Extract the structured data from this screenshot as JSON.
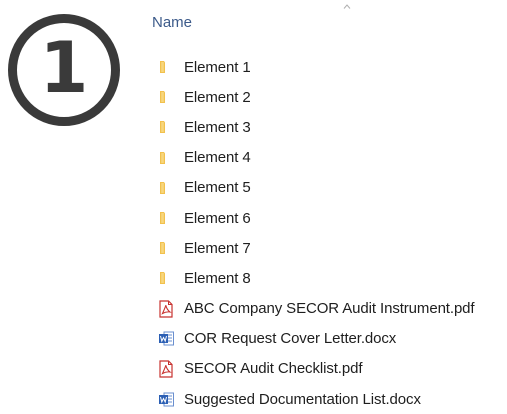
{
  "step_number": "1",
  "header": {
    "name_label": "Name"
  },
  "icons": {
    "folder": "folder-icon",
    "pdf": "pdf-file-icon",
    "word": "word-document-icon"
  },
  "colors": {
    "folder": "#f2c14e",
    "pdf": "#c8322f",
    "word": "#2b5fb4",
    "header_text": "#3c5a8a",
    "badge": "#3a3a3a"
  },
  "items": [
    {
      "type": "folder",
      "label": "Element 1"
    },
    {
      "type": "folder",
      "label": "Element 2"
    },
    {
      "type": "folder",
      "label": "Element 3"
    },
    {
      "type": "folder",
      "label": "Element 4"
    },
    {
      "type": "folder",
      "label": "Element 5"
    },
    {
      "type": "folder",
      "label": "Element 6"
    },
    {
      "type": "folder",
      "label": "Element 7"
    },
    {
      "type": "folder",
      "label": "Element 8"
    },
    {
      "type": "pdf",
      "label": "ABC Company SECOR Audit Instrument.pdf"
    },
    {
      "type": "word",
      "label": "COR Request Cover Letter.docx"
    },
    {
      "type": "pdf",
      "label": "SECOR Audit Checklist.pdf"
    },
    {
      "type": "word",
      "label": "Suggested Documentation List.docx"
    }
  ]
}
